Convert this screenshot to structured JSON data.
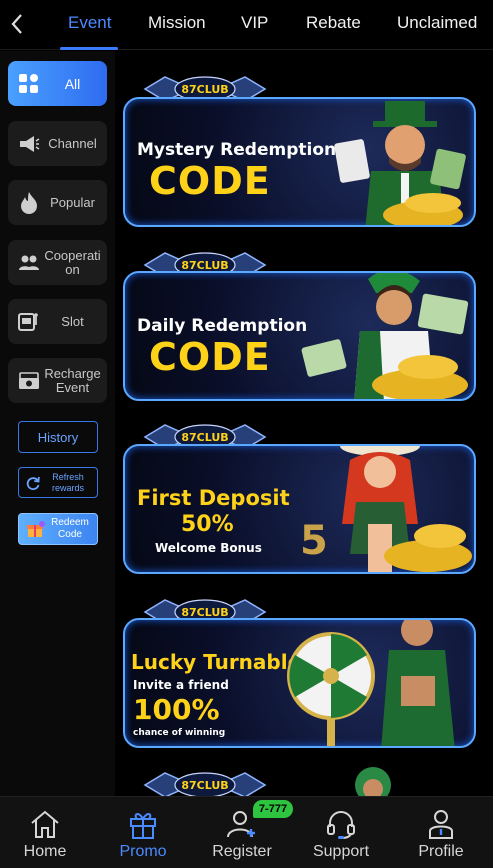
{
  "tabs": [
    {
      "label": "Event",
      "active": true
    },
    {
      "label": "Mission"
    },
    {
      "label": "VIP"
    },
    {
      "label": "Rebate"
    },
    {
      "label": "Unclaimed"
    }
  ],
  "sidebar": {
    "categories": [
      {
        "label": "All",
        "icon": "grid-icon",
        "active": true
      },
      {
        "label": "Channel",
        "icon": "megaphone-icon"
      },
      {
        "label": "Popular",
        "icon": "flame-icon"
      },
      {
        "label": "Cooperation",
        "icon": "people-icon"
      },
      {
        "label": "Slot",
        "icon": "slot-machine-icon"
      },
      {
        "label": "Recharge Event",
        "icon": "cash-icon"
      }
    ],
    "history_label": "History",
    "refresh_label": "Refresh rewards",
    "redeem_label": "Redeem Code"
  },
  "banners": [
    {
      "logo": "87CLUB",
      "line1": "Mystery Redemption",
      "big": "CODE"
    },
    {
      "logo": "87CLUB",
      "line1": "Daily Redemption",
      "big": "CODE"
    },
    {
      "logo": "87CLUB",
      "line1": "First Deposit",
      "mid": "50%",
      "small": "Welcome Bonus"
    },
    {
      "logo": "87CLUB",
      "line1": "Lucky Turnable",
      "sub": "Invite a friend",
      "mid": "100%",
      "small": "chance of winning"
    },
    {
      "logo": "87CLUB"
    }
  ],
  "bottom_nav": [
    {
      "label": "Home",
      "icon": "home-icon"
    },
    {
      "label": "Promo",
      "icon": "gift-icon",
      "active": true
    },
    {
      "label": "Register",
      "icon": "add-user-icon",
      "badge": "7-777"
    },
    {
      "label": "Support",
      "icon": "headset-icon"
    },
    {
      "label": "Profile",
      "icon": "person-icon"
    }
  ],
  "colors": {
    "accent": "#3b7bff",
    "banner_border": "#5aa8ff",
    "highlight_text": "#ffd21a",
    "badge": "#2fc43f"
  }
}
